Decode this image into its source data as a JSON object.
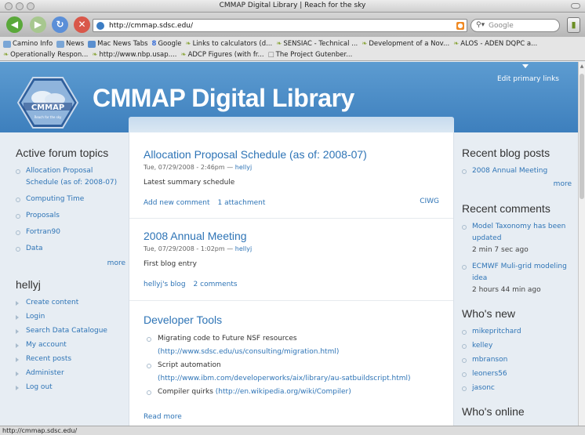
{
  "window": {
    "title": "CMMAP Digital Library | Reach for the sky"
  },
  "toolbar": {
    "url": "http://cmmap.sdsc.edu/",
    "search_placeholder": "Google",
    "search_engine_icon": "magnifier-icon",
    "back_icon": "back-arrow-icon",
    "forward_icon": "forward-arrow-icon",
    "reload_icon": "reload-icon",
    "stop_icon": "stop-icon"
  },
  "bookmarks": {
    "row1": [
      "Camino Info",
      "News",
      "Mac News Tabs",
      "Google",
      "Links to calculators (d...",
      "SENSIAC - Technical ...",
      "Development of a Nov...",
      "ALOS - ADEN DQPC a..."
    ],
    "row2": [
      "Operationally Respon...",
      "http://www.nbp.usap....",
      "ADCP Figures (with fr...",
      "The Project Gutenber..."
    ]
  },
  "header": {
    "site_name": "CMMAP Digital Library",
    "logo_text": "CMMAP",
    "logo_tagline": "Reach for the sky",
    "edit_links": "Edit primary links"
  },
  "left": {
    "forum_title": "Active forum topics",
    "forum_items": [
      "Allocation Proposal Schedule (as of: 2008-07)",
      "Computing Time",
      "Proposals",
      "Fortran90",
      "Data"
    ],
    "forum_more": "more",
    "user_title": "hellyj",
    "user_items": [
      "Create content",
      "Login",
      "Search Data Catalogue",
      "My account",
      "Recent posts",
      "Administer",
      "Log out"
    ]
  },
  "posts": [
    {
      "title": "Allocation Proposal Schedule (as of: 2008-07)",
      "date": "Tue, 07/29/2008 - 2:46pm — ",
      "author": "hellyj",
      "body": "Latest summary schedule",
      "link1": "Add new comment",
      "link2": "1 attachment",
      "tag": "CIWG"
    },
    {
      "title": "2008 Annual Meeting",
      "date": "Tue, 07/29/2008 - 1:02pm — ",
      "author": "hellyj",
      "body": "First blog entry",
      "link1": "hellyj's blog",
      "link2": "2 comments"
    },
    {
      "title": "Developer Tools",
      "items": [
        {
          "text": "Migrating code to Future NSF resources",
          "link": "(http://www.sdsc.edu/us/consulting/migration.html)"
        },
        {
          "text": "Script automation",
          "link": "(http://www.ibm.com/developerworks/aix/library/au-satbuildscript.html)"
        },
        {
          "text": "Compiler quirks ",
          "link": "(http://en.wikipedia.org/wiki/Compiler)"
        }
      ],
      "read_more": "Read more"
    }
  ],
  "right": {
    "blog_title": "Recent blog posts",
    "blog_items": [
      "2008 Annual Meeting"
    ],
    "blog_more": "more",
    "comments_title": "Recent comments",
    "comments": [
      {
        "title": "Model Taxonomy has been updated",
        "ago": "2 min 7 sec ago"
      },
      {
        "title": "ECMWF Muli-grid modeling idea",
        "ago": "2 hours 44 min ago"
      }
    ],
    "new_title": "Who's new",
    "new_items": [
      "mikepritchard",
      "kelley",
      "mbranson",
      "leoners56",
      "jasonc"
    ],
    "online_title": "Who's online"
  },
  "status": {
    "text": "http://cmmap.sdsc.edu/"
  },
  "colors": {
    "link": "#2e74b6",
    "header_blue": "#4a8cc7"
  }
}
